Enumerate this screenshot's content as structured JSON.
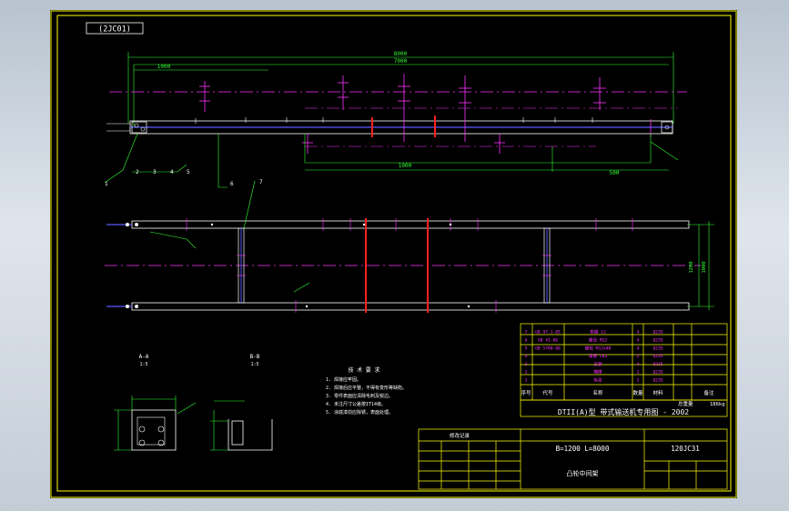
{
  "drawing_code": "(2JC01)",
  "title_line": "DTII(A)型 带式输送机专用图 - 2002",
  "spec": "B=1200 L=8000",
  "part_code": "120JC31",
  "part_name": "凸轮中间架",
  "notes_title": "技 术 要 求",
  "notes": [
    "1. 焊接应牢固。",
    "2. 焊接后应平整，不得有变形等缺陷。",
    "3. 零件表面应清除毛刺及锐边。",
    "4. 未注尺寸公差按IT14级。",
    "5. 涂底漆前应除锈，表面处理。"
  ],
  "dims": {
    "overall_a": "8000",
    "overall_b": "7000",
    "left_sub": "1000",
    "bottom_a": "1000",
    "bottom_b": "500",
    "span": "1200",
    "span_b": "1000"
  },
  "balloons": [
    "1",
    "2",
    "3",
    "4",
    "5",
    "6",
    "7"
  ],
  "section_a": "A-A",
  "section_b": "B-B",
  "section_scale": "1:5",
  "bom_headers": [
    "序号",
    "代号",
    "名称",
    "数量",
    "材料",
    "备注"
  ],
  "bom_rows": [
    [
      "7",
      "GB 97.1-85",
      "垫圈 12",
      "4",
      "Q235",
      ""
    ],
    [
      "6",
      "GB 41-86",
      "螺母 M12",
      "4",
      "Q235",
      ""
    ],
    [
      "5",
      "GB 5780-86",
      "螺栓 M12x40",
      "4",
      "Q235",
      ""
    ],
    [
      "4",
      "",
      "角钢 L63",
      "2",
      "Q235",
      ""
    ],
    [
      "3",
      "",
      "支腿",
      "4",
      "Q235",
      ""
    ],
    [
      "2",
      "",
      "横撑",
      "2",
      "Q235",
      ""
    ],
    [
      "1",
      "",
      "纵梁",
      "2",
      "Q235",
      ""
    ]
  ],
  "mass_label": "总重量",
  "mass_value": "186kg",
  "change_block_title": "修改记录",
  "colors": {
    "frame": "#ffff00",
    "outline": "#ffffff",
    "center": "#ff33ff",
    "dim": "#33ff33",
    "red": "#ff2020",
    "blue": "#5a5aff"
  }
}
